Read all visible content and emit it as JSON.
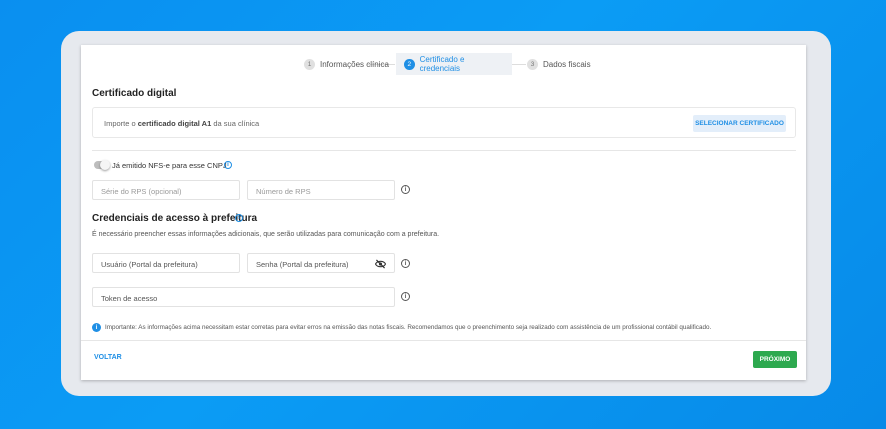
{
  "stepper": {
    "steps": [
      {
        "num": "1",
        "label": "Informações clínica"
      },
      {
        "num": "2",
        "label": "Certificado e credenciais"
      },
      {
        "num": "3",
        "label": "Dados fiscais"
      }
    ]
  },
  "cert": {
    "title": "Certificado digital",
    "text_prefix": "Importe o ",
    "text_bold": "certificado digital A1",
    "text_suffix": " da sua clínica",
    "button": "SELECIONAR CERTIFICADO"
  },
  "nfse": {
    "toggle_label": "Já emitido NFS-e para esse CNPJ",
    "serie_placeholder": "Série do RPS (opcional)",
    "numero_placeholder": "Número de RPS"
  },
  "cred": {
    "title": "Credenciais de acesso à prefeitura",
    "description": "É necessário preencher essas informações adicionais, que serão utilizadas para comunicação com a prefeitura.",
    "usuario_placeholder": "Usuário (Portal da prefeitura)",
    "senha_placeholder": "Senha (Portal da prefeitura)",
    "token_placeholder": "Token de acesso"
  },
  "note": "Importante: As informações acima necessitam estar corretas para evitar erros na emissão das notas fiscais. Recomendamos que o preenchimento seja realizado com assistência de um profissional contábil qualificado.",
  "footer": {
    "back": "VOLTAR",
    "next": "PRÓXIMO"
  },
  "colors": {
    "accent": "#1f8fe5",
    "success": "#2da94f",
    "background": "#0b9cf5"
  }
}
